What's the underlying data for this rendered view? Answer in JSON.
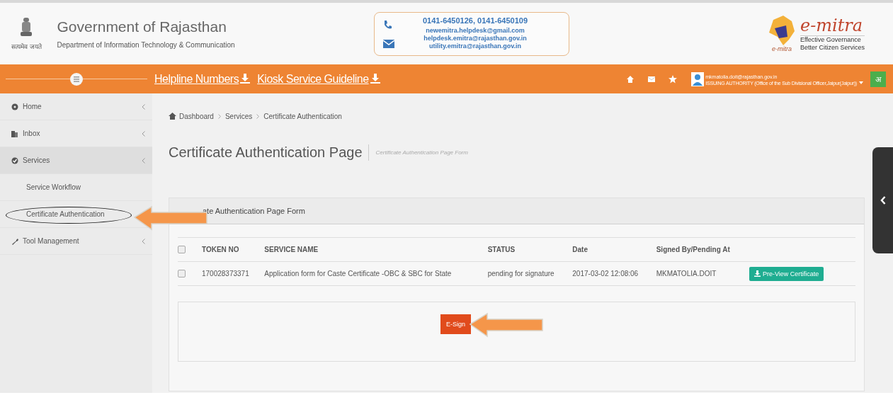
{
  "header": {
    "motto": "सत्यमेव जयते",
    "title": "Government of Rajasthan",
    "subtitle": "Department of Information Technology & Communication",
    "contact": {
      "phones": "0141-6450126, 0141-6450109",
      "emails": [
        "newemitra.helpdesk@gmail.com",
        "helpdesk.emitra@rajasthan.gov.in",
        "utility.emitra@rajasthan.gov.in"
      ]
    },
    "logo": {
      "name": "e-mitra",
      "mark": "e-mitra",
      "tagline": [
        "Effective Governance",
        "Better Citizen Services"
      ]
    }
  },
  "navbar": {
    "links": [
      "Helpline Numbers",
      "Kiosk Service Guideline"
    ],
    "user": {
      "email": "mkmatolia.doit@rajasthan.gov.in",
      "role": "ISSUING AUTHORITY (Office of the Sub Divisional Officer,Jaipur(Jaipur))"
    },
    "language": "अ"
  },
  "sidebar": {
    "items": [
      {
        "label": "Home",
        "selected": false
      },
      {
        "label": "Inbox",
        "selected": false
      },
      {
        "label": "Services",
        "selected": true,
        "children": [
          {
            "label": "Service Workflow",
            "circled": false
          },
          {
            "label": "Certificate Authentication",
            "circled": true
          }
        ]
      },
      {
        "label": "Tool Management",
        "selected": false
      }
    ]
  },
  "breadcrumb": [
    "Dashboard",
    "Services",
    "Certificate Authentication"
  ],
  "page": {
    "title": "Certificate Authentication Page",
    "subtitle": "Certificate Authentication Page Form"
  },
  "panel": {
    "title": "ate Authentication Page Form",
    "table": {
      "all_checked": false,
      "columns": [
        "TOKEN NO",
        "SERVICE NAME",
        "STATUS",
        "Date",
        "Signed By/Pending At"
      ],
      "rows": [
        {
          "checked": false,
          "cells": [
            "170028373371",
            "Application form for Caste Certificate -OBC & SBC for State",
            "pending for signature",
            "2017-03-02 12:08:06",
            "MKMATOLIA.DOIT"
          ],
          "action": "Pre-View Certificate"
        }
      ]
    },
    "submit": "E-Sign"
  }
}
